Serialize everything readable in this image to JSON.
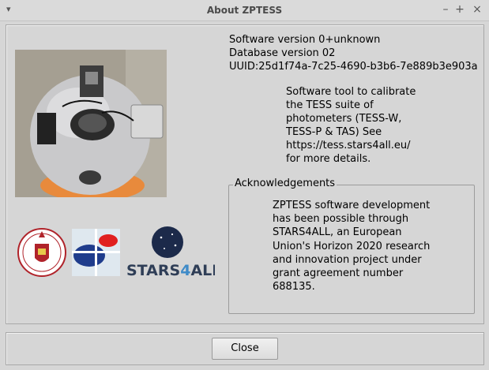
{
  "window": {
    "title": "About ZPTESS",
    "menu_glyph": "▾",
    "minimize_glyph": "–",
    "maximize_glyph": "+",
    "close_glyph": "×"
  },
  "info": {
    "software_version": "Software version 0+unknown",
    "database_version": "Database version 02",
    "uuid": "UUID:25d1f74a-7c25-4690-b3b6-7e889b3e903a"
  },
  "description": [
    "Software tool to calibrate",
    "the TESS suite of",
    "photometers (TESS-W,",
    "TESS-P & TAS) See",
    "https://tess.stars4all.eu/",
    "for more details."
  ],
  "acknowledgements": {
    "legend": "Acknowledgements",
    "lines": [
      "ZPTESS software development",
      "has been possible through",
      "STARS4ALL, an European",
      "Union's Horizon 2020 research",
      "and innovation project under",
      "grant agreement number",
      "688135."
    ]
  },
  "logos": {
    "stars4all_prefix": "STARS",
    "stars4all_digit": "4",
    "stars4all_suffix": "ALL"
  },
  "buttons": {
    "close": "Close"
  },
  "colors": {
    "window_bg": "#d6d6d6",
    "stars4all_text": "#2f3e57",
    "stars4all_digit": "#3f8bc8",
    "ucm_red": "#b0232a",
    "logo_blue": "#1f3c8c",
    "logo_red": "#e02020"
  }
}
